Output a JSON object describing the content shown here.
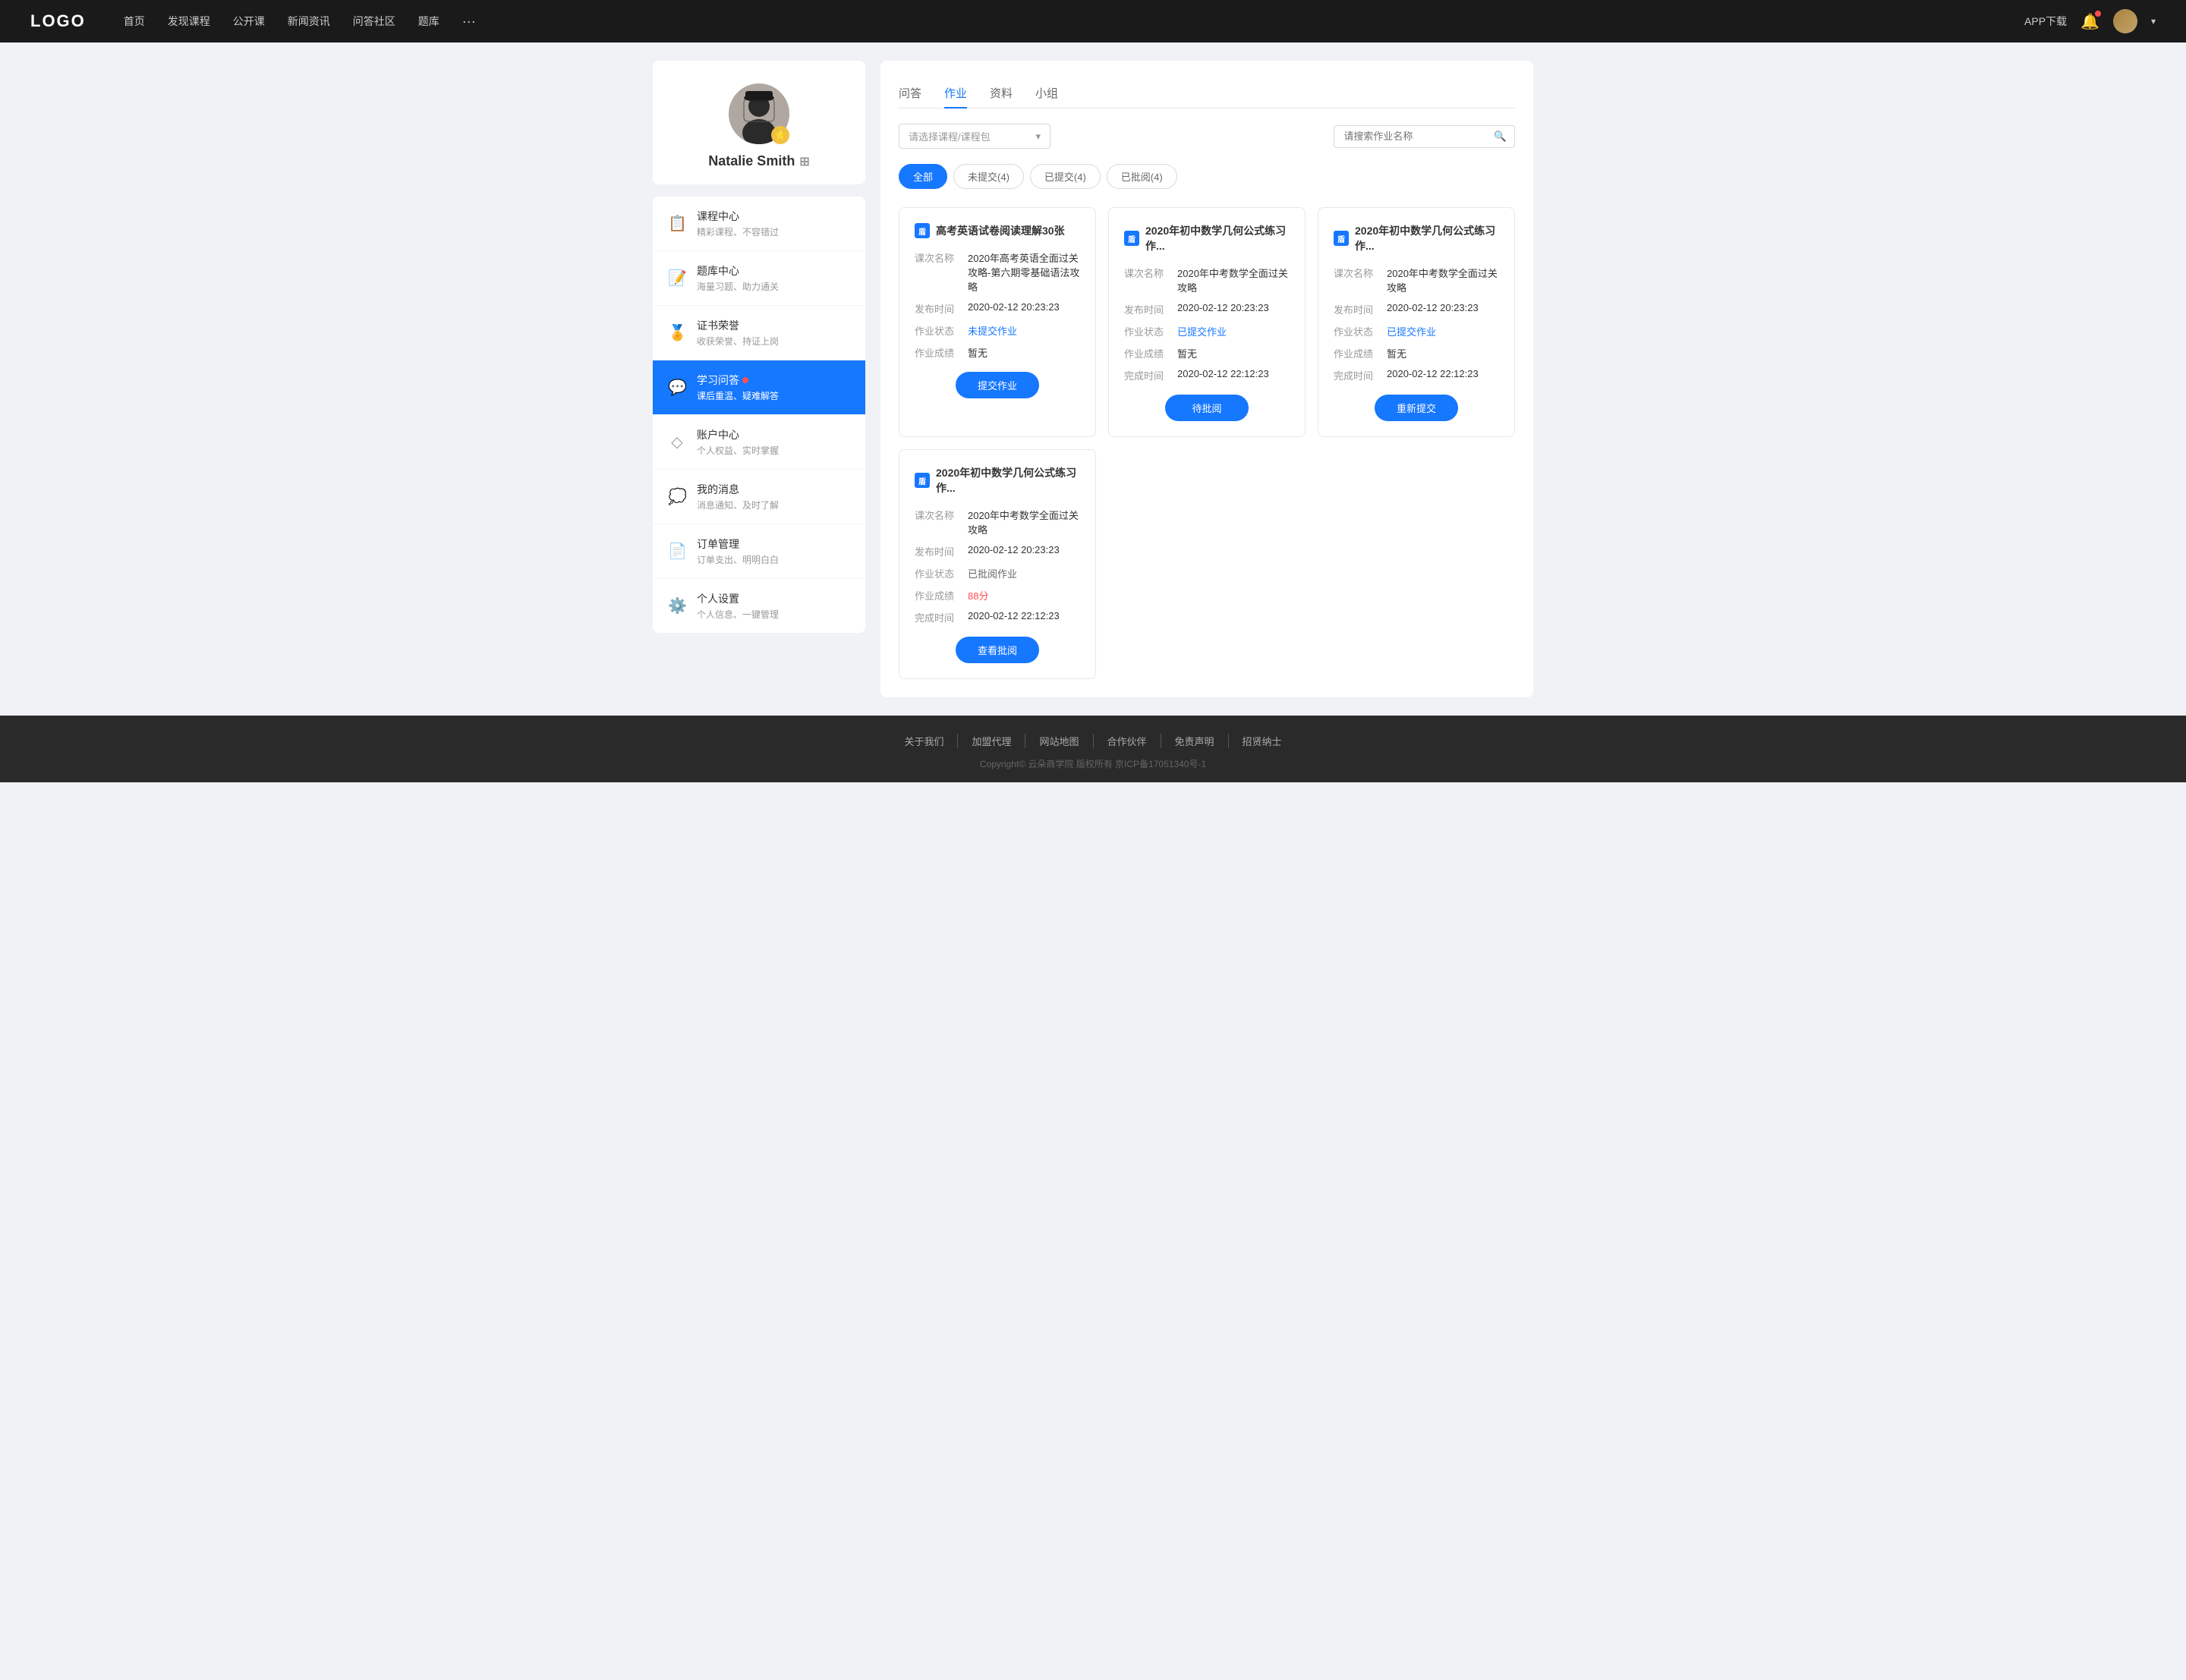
{
  "nav": {
    "logo": "LOGO",
    "links": [
      "首页",
      "发现课程",
      "公开课",
      "新闻资讯",
      "问答社区",
      "题库"
    ],
    "more": "···",
    "download": "APP下载"
  },
  "sidebar": {
    "profile_name": "Natalie Smith",
    "items": [
      {
        "id": "course-center",
        "icon": "📋",
        "title": "课程中心",
        "desc": "精彩课程、不容错过"
      },
      {
        "id": "question-bank",
        "icon": "📝",
        "title": "题库中心",
        "desc": "海量习题、助力通关"
      },
      {
        "id": "certificate",
        "icon": "⚙️",
        "title": "证书荣誉",
        "desc": "收获荣誉、持证上岗"
      },
      {
        "id": "qa",
        "icon": "💬",
        "title": "学习问答",
        "desc": "课后重温、疑难解答",
        "badge": true,
        "active": true
      },
      {
        "id": "account",
        "icon": "◇",
        "title": "账户中心",
        "desc": "个人权益、实时掌握"
      },
      {
        "id": "messages",
        "icon": "💭",
        "title": "我的消息",
        "desc": "消息通知、及时了解"
      },
      {
        "id": "orders",
        "icon": "📄",
        "title": "订单管理",
        "desc": "订单支出、明明白白"
      },
      {
        "id": "settings",
        "icon": "⚙️",
        "title": "个人设置",
        "desc": "个人信息、一键管理"
      }
    ]
  },
  "content": {
    "tabs": [
      "问答",
      "作业",
      "资料",
      "小组"
    ],
    "active_tab": "作业",
    "select_placeholder": "请选择课程/课程包",
    "search_placeholder": "请搜索作业名称",
    "status_filters": [
      {
        "label": "全部",
        "active": true
      },
      {
        "label": "未提交(4)",
        "active": false
      },
      {
        "label": "已提交(4)",
        "active": false
      },
      {
        "label": "已批阅(4)",
        "active": false
      }
    ],
    "cards": [
      {
        "id": "card1",
        "title": "高考英语试卷阅读理解30张",
        "course_name": "2020年高考英语全面过关攻略-第六期零基础语法攻略",
        "publish_time": "2020-02-12 20:23:23",
        "status": "未提交作业",
        "status_type": "unsubmit",
        "score": "暂无",
        "complete_time": null,
        "action": "提交作业",
        "show_complete": false
      },
      {
        "id": "card2",
        "title": "2020年初中数学几何公式练习作...",
        "course_name": "2020年中考数学全面过关攻略",
        "publish_time": "2020-02-12 20:23:23",
        "status": "已提交作业",
        "status_type": "submitted",
        "score": "暂无",
        "complete_time": "2020-02-12 22:12:23",
        "action": "待批阅",
        "show_complete": true
      },
      {
        "id": "card3",
        "title": "2020年初中数学几何公式练习作...",
        "course_name": "2020年中考数学全面过关攻略",
        "publish_time": "2020-02-12 20:23:23",
        "status": "已提交作业",
        "status_type": "submitted",
        "score": "暂无",
        "complete_time": "2020-02-12 22:12:23",
        "action": "重新提交",
        "show_complete": true
      },
      {
        "id": "card4",
        "title": "2020年初中数学几何公式练习作...",
        "course_name": "2020年中考数学全面过关攻略",
        "publish_time": "2020-02-12 20:23:23",
        "status": "已批阅作业",
        "status_type": "reviewed",
        "score": "88分",
        "score_type": "red",
        "complete_time": "2020-02-12 22:12:23",
        "action": "查看批阅",
        "show_complete": true
      }
    ],
    "labels": {
      "course_name": "课次名称",
      "publish_time": "发布时间",
      "status": "作业状态",
      "score": "作业成绩",
      "complete_time": "完成时间"
    }
  },
  "footer": {
    "links": [
      "关于我们",
      "加盟代理",
      "网站地图",
      "合作伙伴",
      "免责声明",
      "招贤纳士"
    ],
    "copyright": "Copyright© 云朵商学院 版权所有    京ICP备17051340号-1"
  }
}
